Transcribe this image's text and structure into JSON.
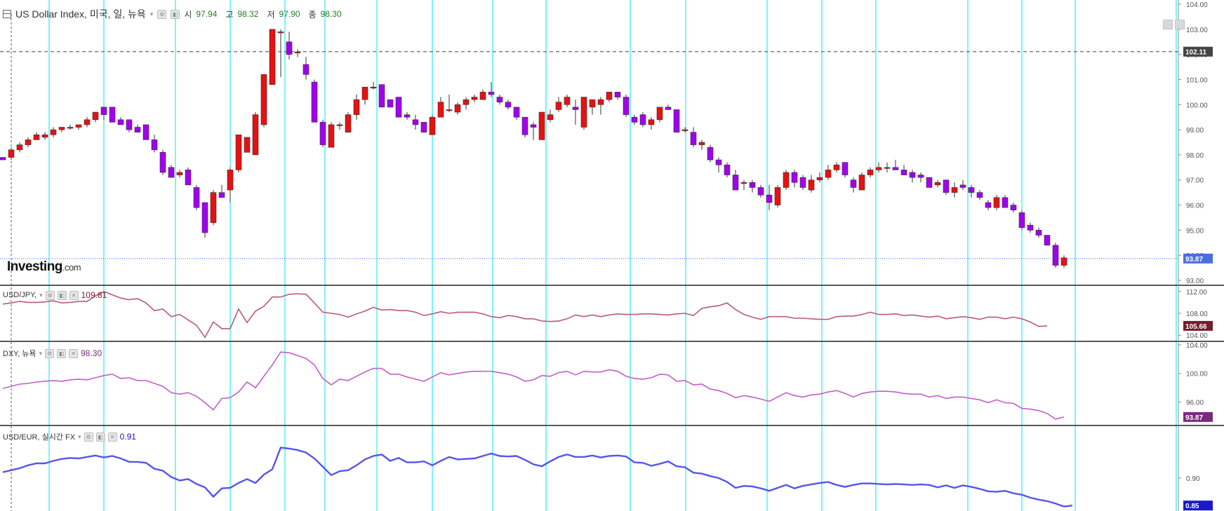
{
  "main_legend": {
    "title": "US Dollar Index, 미국, 일, 뉴욕",
    "open_label": "시",
    "open": "97.94",
    "high_label": "고",
    "high": "98.32",
    "low_label": "저",
    "low": "97.90",
    "close_label": "종",
    "close": "98.30"
  },
  "logo": {
    "brand": "Investing",
    "suffix": ".com"
  },
  "panes": [
    {
      "label": "USD/JPY,",
      "value": "109.81",
      "value_color": "#7a1a2a"
    },
    {
      "label": "DXY, 뉴욕",
      "value": "98.30",
      "value_color": "#7a2a80"
    },
    {
      "label": "USD/EUR, 실시간 FX",
      "value": "0.91",
      "value_color": "#1a1aaa"
    }
  ],
  "colors": {
    "up": "#e81010",
    "down": "#a000ee",
    "usdjpy": "#b85a78",
    "dxy": "#c060c8",
    "usdeur": "#5555ee",
    "vline": "#00e5ee"
  },
  "chart_data": [
    {
      "type": "candlestick",
      "title": "US Dollar Index",
      "ylim": [
        93.0,
        104.0
      ],
      "yticks": [
        "104.00",
        "103.00",
        "102.00",
        "101.00",
        "100.00",
        "99.00",
        "98.00",
        "97.00",
        "96.00",
        "95.00",
        "94.00",
        "93.00"
      ],
      "reference_lines": [
        {
          "value": 102.11,
          "label": "102.11",
          "style": "dashed",
          "color": "#444444"
        },
        {
          "value": 93.87,
          "label": "93.87",
          "style": "dotted",
          "color": "#3366ee"
        }
      ],
      "candles": [
        [
          97.9,
          97.9,
          97.8,
          97.8
        ],
        [
          97.9,
          98.3,
          97.8,
          98.2
        ],
        [
          98.2,
          98.5,
          98.1,
          98.4
        ],
        [
          98.4,
          98.7,
          98.3,
          98.6
        ],
        [
          98.6,
          98.9,
          98.6,
          98.8
        ],
        [
          98.7,
          98.9,
          98.6,
          98.8
        ],
        [
          98.8,
          99.1,
          98.7,
          99.0
        ],
        [
          99.0,
          99.1,
          98.9,
          99.1
        ],
        [
          99.1,
          99.2,
          99.0,
          99.1
        ],
        [
          99.1,
          99.2,
          99.0,
          99.2
        ],
        [
          99.2,
          99.5,
          99.1,
          99.4
        ],
        [
          99.4,
          99.7,
          99.3,
          99.7
        ],
        [
          99.9,
          99.9,
          99.4,
          99.6
        ],
        [
          99.9,
          99.9,
          99.3,
          99.3
        ],
        [
          99.4,
          99.5,
          99.2,
          99.2
        ],
        [
          99.4,
          99.4,
          98.9,
          99.0
        ],
        [
          99.1,
          99.2,
          98.9,
          98.9
        ],
        [
          99.2,
          99.2,
          98.6,
          98.6
        ],
        [
          98.6,
          98.8,
          98.1,
          98.2
        ],
        [
          98.1,
          98.2,
          97.2,
          97.3
        ],
        [
          97.5,
          97.6,
          97.1,
          97.1
        ],
        [
          97.2,
          97.4,
          97.1,
          97.3
        ],
        [
          97.4,
          97.5,
          96.8,
          96.8
        ],
        [
          96.7,
          96.8,
          95.8,
          95.9
        ],
        [
          96.1,
          96.1,
          94.7,
          94.9
        ],
        [
          95.3,
          96.6,
          95.2,
          96.5
        ],
        [
          96.5,
          96.8,
          96.3,
          96.3
        ],
        [
          96.6,
          97.5,
          96.1,
          97.4
        ],
        [
          97.4,
          98.8,
          97.3,
          98.8
        ],
        [
          98.1,
          98.7,
          98.1,
          98.7
        ],
        [
          98.0,
          99.7,
          98.0,
          99.6
        ],
        [
          99.2,
          101.2,
          99.1,
          101.2
        ],
        [
          100.8,
          103.0,
          100.8,
          103.0
        ],
        [
          102.9,
          103.0,
          101.1,
          102.9
        ],
        [
          102.5,
          102.9,
          101.8,
          102.0
        ],
        [
          102.1,
          102.2,
          101.9,
          102.1
        ],
        [
          101.6,
          101.9,
          101.0,
          101.2
        ],
        [
          100.9,
          101.0,
          99.3,
          99.3
        ],
        [
          99.3,
          99.4,
          98.3,
          98.4
        ],
        [
          98.3,
          99.3,
          98.3,
          99.2
        ],
        [
          99.2,
          99.3,
          99.0,
          99.2
        ],
        [
          98.9,
          99.7,
          98.9,
          99.6
        ],
        [
          99.6,
          100.4,
          99.4,
          100.2
        ],
        [
          100.2,
          100.7,
          100.0,
          100.7
        ],
        [
          100.7,
          100.9,
          100.6,
          100.7
        ],
        [
          100.8,
          100.8,
          99.9,
          99.9
        ],
        [
          100.2,
          100.2,
          99.9,
          99.9
        ],
        [
          100.3,
          100.3,
          99.5,
          99.5
        ],
        [
          99.6,
          99.7,
          99.4,
          99.5
        ],
        [
          99.4,
          99.6,
          99.0,
          99.2
        ],
        [
          99.3,
          99.3,
          98.9,
          98.9
        ],
        [
          98.8,
          99.6,
          98.8,
          99.5
        ],
        [
          99.5,
          100.3,
          99.5,
          100.1
        ],
        [
          99.8,
          100.4,
          99.7,
          99.8
        ],
        [
          99.7,
          100.1,
          99.6,
          100.0
        ],
        [
          100.0,
          100.3,
          99.8,
          100.2
        ],
        [
          100.2,
          100.4,
          100.1,
          100.3
        ],
        [
          100.2,
          100.6,
          100.2,
          100.5
        ],
        [
          100.5,
          100.9,
          100.3,
          100.4
        ],
        [
          100.3,
          100.4,
          100.0,
          100.1
        ],
        [
          100.1,
          100.2,
          99.8,
          99.9
        ],
        [
          99.9,
          99.9,
          99.4,
          99.5
        ],
        [
          99.5,
          99.5,
          98.7,
          98.8
        ],
        [
          99.2,
          99.3,
          98.6,
          99.1
        ],
        [
          98.6,
          99.7,
          98.6,
          99.7
        ],
        [
          99.4,
          99.8,
          99.3,
          99.6
        ],
        [
          99.8,
          100.3,
          99.7,
          100.1
        ],
        [
          100.0,
          100.4,
          99.9,
          100.3
        ],
        [
          99.9,
          100.2,
          99.2,
          99.8
        ],
        [
          99.1,
          100.3,
          99.0,
          100.3
        ],
        [
          99.9,
          100.2,
          99.6,
          100.2
        ],
        [
          100.0,
          100.3,
          99.6,
          100.2
        ],
        [
          100.2,
          100.5,
          100.1,
          100.5
        ],
        [
          100.5,
          100.5,
          100.2,
          100.3
        ],
        [
          100.3,
          100.4,
          99.5,
          99.6
        ],
        [
          99.5,
          99.6,
          99.2,
          99.3
        ],
        [
          99.6,
          99.7,
          99.1,
          99.2
        ],
        [
          99.2,
          99.5,
          99.0,
          99.4
        ],
        [
          99.4,
          99.9,
          99.3,
          99.9
        ],
        [
          99.9,
          100.0,
          99.8,
          99.8
        ],
        [
          99.8,
          99.8,
          98.9,
          98.9
        ],
        [
          99.0,
          99.1,
          98.9,
          99.0
        ],
        [
          98.9,
          99.1,
          98.3,
          98.4
        ],
        [
          98.4,
          98.6,
          98.2,
          98.5
        ],
        [
          98.3,
          98.4,
          97.7,
          97.8
        ],
        [
          97.8,
          97.9,
          97.3,
          97.6
        ],
        [
          97.6,
          97.7,
          97.1,
          97.2
        ],
        [
          97.2,
          97.4,
          96.6,
          96.6
        ],
        [
          96.9,
          97.0,
          96.6,
          96.9
        ],
        [
          96.9,
          97.0,
          96.5,
          96.7
        ],
        [
          96.7,
          96.8,
          96.3,
          96.4
        ],
        [
          96.4,
          96.8,
          95.8,
          96.1
        ],
        [
          96.0,
          96.8,
          95.9,
          96.7
        ],
        [
          96.7,
          97.4,
          96.6,
          97.3
        ],
        [
          97.3,
          97.4,
          96.7,
          96.9
        ],
        [
          97.1,
          97.2,
          96.6,
          96.7
        ],
        [
          96.6,
          97.2,
          96.5,
          97.0
        ],
        [
          97.0,
          97.3,
          96.9,
          97.1
        ],
        [
          97.1,
          97.6,
          97.0,
          97.4
        ],
        [
          97.4,
          97.7,
          97.3,
          97.6
        ],
        [
          97.7,
          97.7,
          97.1,
          97.2
        ],
        [
          97.0,
          97.1,
          96.5,
          96.7
        ],
        [
          96.6,
          97.3,
          96.6,
          97.2
        ],
        [
          97.2,
          97.5,
          97.1,
          97.4
        ],
        [
          97.4,
          97.7,
          97.3,
          97.5
        ],
        [
          97.5,
          97.7,
          97.3,
          97.5
        ],
        [
          97.5,
          97.8,
          97.4,
          97.4
        ],
        [
          97.4,
          97.6,
          97.2,
          97.2
        ],
        [
          97.3,
          97.4,
          96.9,
          97.1
        ],
        [
          97.2,
          97.3,
          96.9,
          97.1
        ],
        [
          97.1,
          97.1,
          96.7,
          96.7
        ],
        [
          96.8,
          97.0,
          96.7,
          96.9
        ],
        [
          97.0,
          97.0,
          96.4,
          96.5
        ],
        [
          96.5,
          96.9,
          96.3,
          96.7
        ],
        [
          96.8,
          97.0,
          96.6,
          96.7
        ],
        [
          96.7,
          96.8,
          96.3,
          96.5
        ],
        [
          96.5,
          96.6,
          96.2,
          96.3
        ],
        [
          96.1,
          96.2,
          95.8,
          95.9
        ],
        [
          95.9,
          96.4,
          95.8,
          96.3
        ],
        [
          96.3,
          96.4,
          95.9,
          95.9
        ],
        [
          96.0,
          96.1,
          95.7,
          95.8
        ],
        [
          95.7,
          95.8,
          95.0,
          95.1
        ],
        [
          95.2,
          95.3,
          94.9,
          95.0
        ],
        [
          95.0,
          95.1,
          94.7,
          94.8
        ],
        [
          94.8,
          94.8,
          94.4,
          94.4
        ],
        [
          94.4,
          94.5,
          93.5,
          93.6
        ],
        [
          93.6,
          94.0,
          93.5,
          93.9
        ]
      ],
      "last_value": "93.87"
    },
    {
      "type": "line",
      "name": "USD/JPY",
      "ylim": [
        103.5,
        112.5
      ],
      "yticks": [
        "112.00",
        "108.00",
        "104.00"
      ],
      "last_value": "105.66",
      "values": [
        109.7,
        109.9,
        110.2,
        110.0,
        110.0,
        110.1,
        110.3,
        109.9,
        110.0,
        110.2,
        110.2,
        111.2,
        112.0,
        111.4,
        110.8,
        110.5,
        110.7,
        109.9,
        108.5,
        108.8,
        107.4,
        107.8,
        106.8,
        105.8,
        103.6,
        106.4,
        105.2,
        105.2,
        108.8,
        106.3,
        108.4,
        109.3,
        111.0,
        111.0,
        111.5,
        111.6,
        111.5,
        109.9,
        108.2,
        108.0,
        107.8,
        107.3,
        107.9,
        108.4,
        109.1,
        108.6,
        108.7,
        108.5,
        108.5,
        108.2,
        107.6,
        107.9,
        108.3,
        108.0,
        108.2,
        108.2,
        108.2,
        107.9,
        107.4,
        107.2,
        107.6,
        107.4,
        107.0,
        107.0,
        106.6,
        106.5,
        106.6,
        107.0,
        107.7,
        107.4,
        107.7,
        107.4,
        107.7,
        107.9,
        107.8,
        107.8,
        107.9,
        107.9,
        107.8,
        107.7,
        107.9,
        108.0,
        107.6,
        108.9,
        109.2,
        109.4,
        109.9,
        108.7,
        107.8,
        107.3,
        106.9,
        107.4,
        107.4,
        107.4,
        107.1,
        107.1,
        107.0,
        106.9,
        106.9,
        107.4,
        107.5,
        107.5,
        107.8,
        108.2,
        107.8,
        107.8,
        107.9,
        107.6,
        107.7,
        107.5,
        107.3,
        107.5,
        107.0,
        107.2,
        107.4,
        107.2,
        106.9,
        107.3,
        107.3,
        107.0,
        107.3,
        107.0,
        106.4,
        105.6,
        105.7
      ]
    },
    {
      "type": "line",
      "name": "DXY",
      "ylim": [
        93.2,
        104.0
      ],
      "yticks": [
        "104.00",
        "100.00",
        "96.00"
      ],
      "last_value": "93.87",
      "values": [
        97.9,
        98.2,
        98.5,
        98.6,
        98.8,
        98.9,
        99.0,
        98.9,
        99.1,
        99.2,
        99.1,
        99.4,
        99.7,
        99.9,
        99.3,
        99.4,
        99.0,
        99.0,
        98.6,
        98.2,
        97.3,
        97.1,
        97.3,
        96.8,
        95.9,
        94.9,
        96.5,
        96.6,
        97.4,
        98.8,
        98.0,
        99.6,
        101.2,
        103.0,
        102.9,
        102.5,
        102.1,
        101.2,
        99.3,
        98.4,
        99.2,
        99.0,
        99.6,
        100.2,
        100.7,
        100.7,
        99.9,
        99.9,
        99.5,
        99.2,
        98.9,
        99.5,
        100.1,
        99.8,
        100.0,
        100.2,
        100.3,
        100.3,
        100.3,
        100.1,
        99.9,
        99.5,
        98.9,
        99.1,
        99.7,
        99.6,
        100.1,
        100.3,
        99.8,
        100.3,
        100.2,
        100.2,
        100.5,
        100.3,
        99.6,
        99.3,
        99.2,
        99.4,
        99.9,
        99.8,
        98.9,
        99.0,
        98.4,
        98.5,
        97.8,
        97.6,
        97.2,
        96.6,
        96.9,
        96.7,
        96.4,
        96.1,
        96.7,
        97.3,
        96.9,
        96.7,
        97.0,
        97.1,
        97.4,
        97.6,
        97.2,
        96.7,
        97.2,
        97.4,
        97.5,
        97.5,
        97.4,
        97.2,
        97.1,
        97.1,
        96.7,
        96.9,
        96.5,
        96.7,
        96.7,
        96.5,
        96.3,
        95.9,
        96.3,
        95.9,
        95.8,
        95.1,
        95.0,
        94.8,
        94.4,
        93.6,
        93.9
      ]
    },
    {
      "type": "line",
      "name": "USD/EUR",
      "ylim": [
        0.84,
        1.0
      ],
      "yticks": [
        "0.90"
      ],
      "last_value": "0.85",
      "values": [
        0.912,
        0.916,
        0.92,
        0.926,
        0.93,
        0.93,
        0.935,
        0.939,
        0.941,
        0.94,
        0.943,
        0.946,
        0.942,
        0.945,
        0.94,
        0.933,
        0.933,
        0.931,
        0.919,
        0.915,
        0.902,
        0.895,
        0.898,
        0.888,
        0.881,
        0.862,
        0.879,
        0.88,
        0.89,
        0.898,
        0.89,
        0.907,
        0.918,
        0.962,
        0.96,
        0.957,
        0.952,
        0.94,
        0.923,
        0.906,
        0.914,
        0.916,
        0.926,
        0.938,
        0.945,
        0.948,
        0.935,
        0.941,
        0.932,
        0.932,
        0.934,
        0.926,
        0.935,
        0.943,
        0.938,
        0.939,
        0.94,
        0.945,
        0.95,
        0.945,
        0.944,
        0.945,
        0.937,
        0.928,
        0.924,
        0.934,
        0.943,
        0.948,
        0.943,
        0.943,
        0.946,
        0.942,
        0.945,
        0.946,
        0.944,
        0.932,
        0.931,
        0.925,
        0.929,
        0.934,
        0.924,
        0.922,
        0.911,
        0.909,
        0.904,
        0.9,
        0.892,
        0.88,
        0.884,
        0.883,
        0.879,
        0.874,
        0.88,
        0.886,
        0.879,
        0.884,
        0.887,
        0.89,
        0.892,
        0.886,
        0.882,
        0.886,
        0.889,
        0.889,
        0.888,
        0.887,
        0.888,
        0.887,
        0.886,
        0.887,
        0.886,
        0.881,
        0.885,
        0.88,
        0.885,
        0.882,
        0.878,
        0.873,
        0.872,
        0.874,
        0.869,
        0.866,
        0.86,
        0.856,
        0.853,
        0.848,
        0.842,
        0.844
      ]
    }
  ]
}
